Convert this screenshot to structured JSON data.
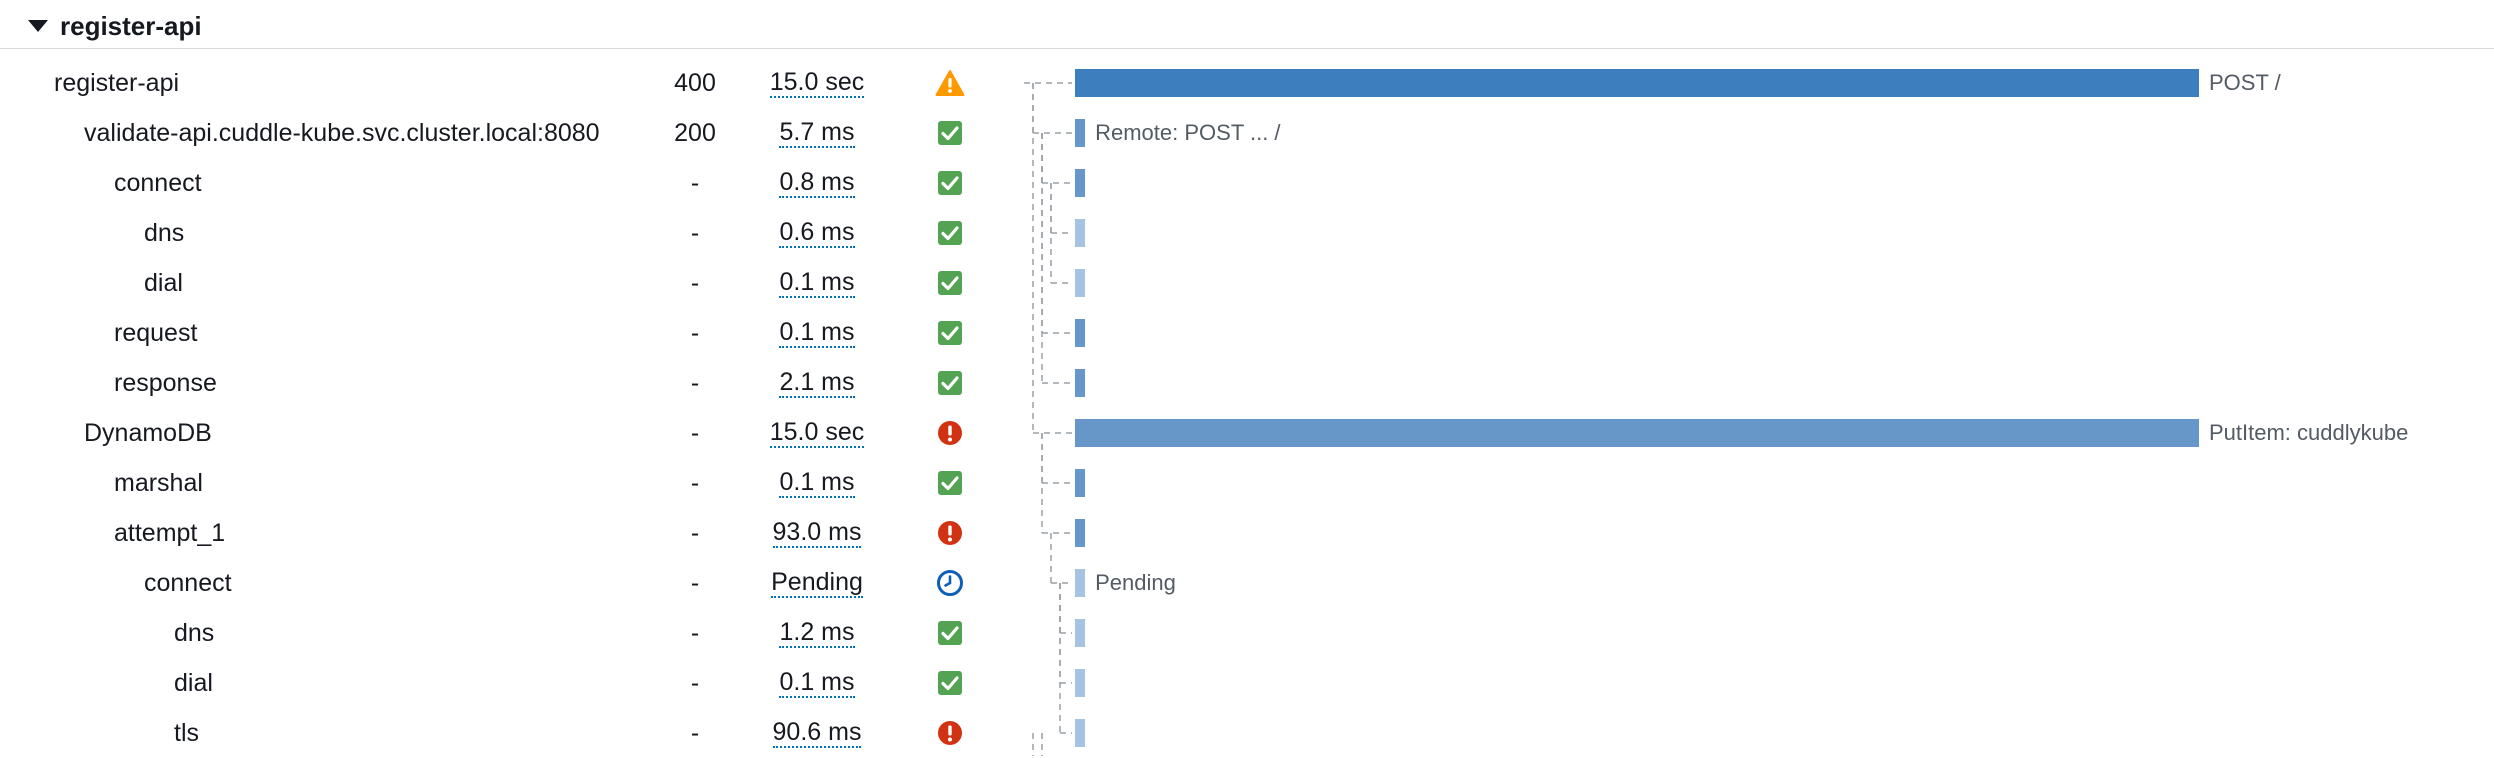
{
  "group": {
    "title": "register-api"
  },
  "colors": {
    "bar_dark": "#3d7ebf",
    "bar_mid": "#6796c9",
    "bar_light": "#a7c3e3",
    "ok": "#53a352",
    "error": "#d13212",
    "warn": "#ff9900",
    "pending": "#0b5fb7"
  },
  "rows": [
    {
      "name": "register-api",
      "depth": 0,
      "status": "400",
      "duration": "15.0 sec",
      "icon": "warning-icon",
      "bar_start": 0,
      "bar_end": 1,
      "bar_shade": "dark",
      "label": "POST /"
    },
    {
      "name": "validate-api.cuddle-kube.svc.cluster.local:8080",
      "depth": 1,
      "status": "200",
      "duration": "5.7 ms",
      "icon": "check-icon",
      "bar_start": 0,
      "bar_end": 0.009,
      "bar_shade": "mid",
      "label": "Remote: POST ... /"
    },
    {
      "name": "connect",
      "depth": 2,
      "status": "-",
      "duration": "0.8 ms",
      "icon": "check-icon",
      "bar_start": 0,
      "bar_end": 0.009,
      "bar_shade": "mid",
      "label": ""
    },
    {
      "name": "dns",
      "depth": 3,
      "status": "-",
      "duration": "0.6 ms",
      "icon": "check-icon",
      "bar_start": 0,
      "bar_end": 0.009,
      "bar_shade": "light",
      "label": ""
    },
    {
      "name": "dial",
      "depth": 3,
      "status": "-",
      "duration": "0.1 ms",
      "icon": "check-icon",
      "bar_start": 0,
      "bar_end": 0.009,
      "bar_shade": "light",
      "label": ""
    },
    {
      "name": "request",
      "depth": 2,
      "status": "-",
      "duration": "0.1 ms",
      "icon": "check-icon",
      "bar_start": 0,
      "bar_end": 0.009,
      "bar_shade": "mid",
      "label": ""
    },
    {
      "name": "response",
      "depth": 2,
      "status": "-",
      "duration": "2.1 ms",
      "icon": "check-icon",
      "bar_start": 0,
      "bar_end": 0.009,
      "bar_shade": "mid",
      "label": ""
    },
    {
      "name": "DynamoDB",
      "depth": 1,
      "status": "-",
      "duration": "15.0 sec",
      "icon": "error-icon",
      "bar_start": 0,
      "bar_end": 1,
      "bar_shade": "mid",
      "label": "PutItem: cuddlykube"
    },
    {
      "name": "marshal",
      "depth": 2,
      "status": "-",
      "duration": "0.1 ms",
      "icon": "check-icon",
      "bar_start": 0,
      "bar_end": 0.009,
      "bar_shade": "mid",
      "label": ""
    },
    {
      "name": "attempt_1",
      "depth": 2,
      "status": "-",
      "duration": "93.0 ms",
      "icon": "error-icon",
      "bar_start": 0,
      "bar_end": 0.009,
      "bar_shade": "mid",
      "label": ""
    },
    {
      "name": "connect",
      "depth": 3,
      "status": "-",
      "duration": "Pending",
      "icon": "clock-icon",
      "bar_start": 0,
      "bar_end": 0.009,
      "bar_shade": "light",
      "label": "Pending"
    },
    {
      "name": "dns",
      "depth": 4,
      "status": "-",
      "duration": "1.2 ms",
      "icon": "check-icon",
      "bar_start": 0,
      "bar_end": 0.009,
      "bar_shade": "light",
      "label": ""
    },
    {
      "name": "dial",
      "depth": 4,
      "status": "-",
      "duration": "0.1 ms",
      "icon": "check-icon",
      "bar_start": 0,
      "bar_end": 0.009,
      "bar_shade": "light",
      "label": ""
    },
    {
      "name": "tls",
      "depth": 4,
      "status": "-",
      "duration": "90.6 ms",
      "icon": "error-icon",
      "bar_start": 0,
      "bar_end": 0.009,
      "bar_shade": "light",
      "label": ""
    }
  ]
}
